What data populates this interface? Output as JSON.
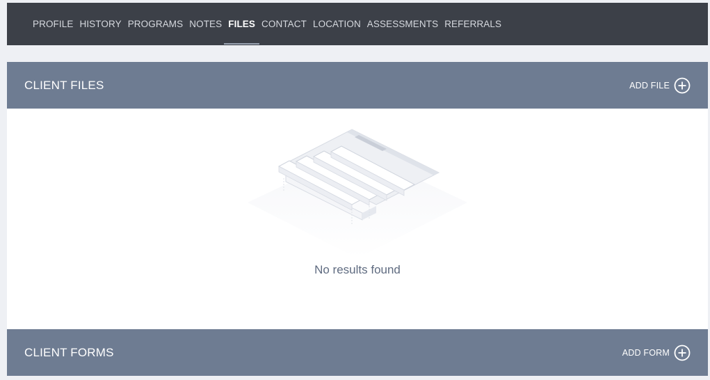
{
  "nav": {
    "tabs": [
      {
        "label": "PROFILE",
        "active": false
      },
      {
        "label": "HISTORY",
        "active": false
      },
      {
        "label": "PROGRAMS",
        "active": false
      },
      {
        "label": "NOTES",
        "active": false
      },
      {
        "label": "FILES",
        "active": true
      },
      {
        "label": "CONTACT",
        "active": false
      },
      {
        "label": "LOCATION",
        "active": false
      },
      {
        "label": "ASSESSMENTS",
        "active": false
      },
      {
        "label": "REFERRALS",
        "active": false
      }
    ]
  },
  "client_files": {
    "title": "CLIENT FILES",
    "add_label": "ADD FILE",
    "add_icon": "plus-circle-icon",
    "empty_message": "No results found",
    "empty_icon": "empty-documents-illustration"
  },
  "client_forms": {
    "title": "CLIENT FORMS",
    "add_label": "ADD FORM",
    "add_icon": "plus-circle-icon"
  },
  "colors": {
    "nav_bg": "#3c4048",
    "header_bg": "#6e7c92",
    "page_bg": "#eef0f4",
    "empty_text": "#5f6b80"
  }
}
